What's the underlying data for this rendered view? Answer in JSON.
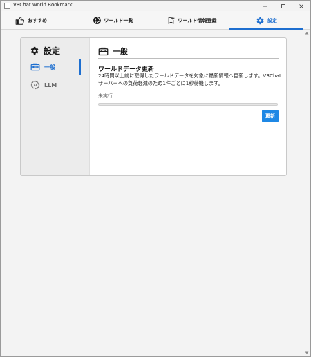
{
  "window": {
    "title": "VRChat World Bookmark",
    "controls": [
      "minimize-icon",
      "maximize-icon",
      "close-icon"
    ]
  },
  "tabs": [
    {
      "label": "おすすめ",
      "icon": "thumbs-up-icon",
      "active": false
    },
    {
      "label": "ワールド一覧",
      "icon": "globe-icon",
      "active": false
    },
    {
      "label": "ワールド情報登録",
      "icon": "bookmark-add-icon",
      "active": false
    },
    {
      "label": "設定",
      "icon": "gear-icon",
      "active": true
    }
  ],
  "settings": {
    "title": "設定",
    "menu": [
      {
        "label": "一般",
        "icon": "toolbox-icon",
        "active": true
      },
      {
        "label": "LLM",
        "icon": "ai-icon",
        "active": false
      }
    ]
  },
  "general": {
    "header": "一般",
    "card": {
      "title": "ワールドデータ更新",
      "description": "24時間以上前に取得したワールドデータを対象に最新情報へ更新します。VRChatサーバーへの負荷軽減のため1件ごとに1秒待機します。",
      "status": "未実行",
      "progress": 0,
      "button_label": "更新"
    }
  },
  "colors": {
    "accent": "#1e6fd0",
    "button": "#1e88e5",
    "sidebar_bg": "#ececec",
    "page_bg": "#f3f3f3"
  }
}
